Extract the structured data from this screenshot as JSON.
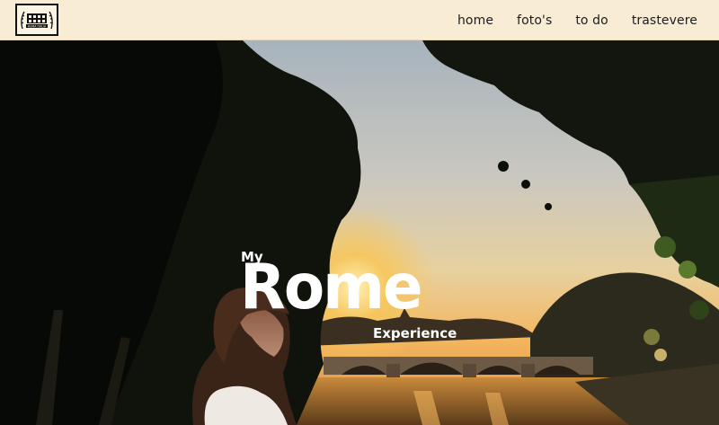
{
  "logo": {
    "text": "ROMA ITALIA",
    "icon": "colosseum-icon"
  },
  "nav": {
    "items": [
      {
        "label": "home"
      },
      {
        "label": "foto's"
      },
      {
        "label": "to do"
      },
      {
        "label": "trastevere"
      }
    ]
  },
  "hero": {
    "title_small": "My",
    "title_big": "Rome",
    "title_sub": "Experience"
  },
  "colors": {
    "nav_bg": "#f8ecd4",
    "nav_text": "#1d1d1d",
    "title_text": "#ffffff",
    "sky_top": "#a7b3bd",
    "sunset": "#f7c65a"
  }
}
